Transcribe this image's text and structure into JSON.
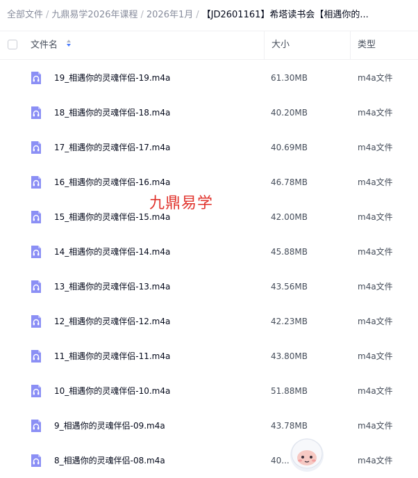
{
  "breadcrumb": {
    "items": [
      "全部文件",
      "九鼎易学2026年课程",
      "2026年1月"
    ],
    "separator": "/",
    "current": "【JD2601161】希塔读书会【相遇你的..."
  },
  "header": {
    "name_label": "文件名",
    "size_label": "大小",
    "type_label": "类型"
  },
  "files": [
    {
      "name": "19_相遇你的灵魂伴侣-19.m4a",
      "size": "61.30MB",
      "type": "m4a文件"
    },
    {
      "name": "18_相遇你的灵魂伴侣-18.m4a",
      "size": "40.20MB",
      "type": "m4a文件"
    },
    {
      "name": "17_相遇你的灵魂伴侣-17.m4a",
      "size": "40.69MB",
      "type": "m4a文件"
    },
    {
      "name": "16_相遇你的灵魂伴侣-16.m4a",
      "size": "46.78MB",
      "type": "m4a文件"
    },
    {
      "name": "15_相遇你的灵魂伴侣-15.m4a",
      "size": "42.00MB",
      "type": "m4a文件"
    },
    {
      "name": "14_相遇你的灵魂伴侣-14.m4a",
      "size": "45.88MB",
      "type": "m4a文件"
    },
    {
      "name": "13_相遇你的灵魂伴侣-13.m4a",
      "size": "43.56MB",
      "type": "m4a文件"
    },
    {
      "name": "12_相遇你的灵魂伴侣-12.m4a",
      "size": "42.23MB",
      "type": "m4a文件"
    },
    {
      "name": "11_相遇你的灵魂伴侣-11.m4a",
      "size": "43.80MB",
      "type": "m4a文件"
    },
    {
      "name": "10_相遇你的灵魂伴侣-10.m4a",
      "size": "51.88MB",
      "type": "m4a文件"
    },
    {
      "name": "9_相遇你的灵魂伴侣-09.m4a",
      "size": "43.78MB",
      "type": "m4a文件"
    },
    {
      "name": "8_相遇你的灵魂伴侣-08.m4a",
      "size": "40...",
      "type": "m4a文件"
    }
  ],
  "watermark": "九鼎易学",
  "icons": {
    "file_icon": "headphones-file-icon",
    "sort_icon": "sort-arrows-icon",
    "mascot": "assistant-mascot-icon"
  },
  "colors": {
    "file_icon": "#8b8ff5",
    "watermark": "#e0322b",
    "sort_active": "#4a7cff"
  }
}
